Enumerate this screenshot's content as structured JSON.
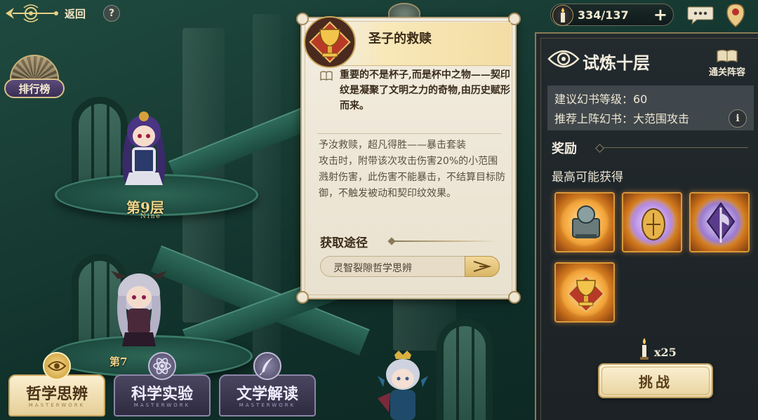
{
  "topbar": {
    "back_label": "返回",
    "help_glyph": "?",
    "stamina": "334/137",
    "plus_glyph": "+"
  },
  "left": {
    "rank_label": "排行榜",
    "floor9_label": "第9层",
    "floor9_sub": "Nine",
    "floor8_label": "第7"
  },
  "tooltip": {
    "title": "圣子的救赎",
    "quote": "重要的不是杯子,而是杯中之物——契印纹是凝聚了文明之力的奇物,由历史赋形而来。",
    "desc_1": "予汝救赎，超凡得胜——暴击套装",
    "desc_2": "攻击时，附带该次攻击伤害20%的小范围溅射伤害，此伤害不能暴击，不结算目标防御，不触发被动和契印纹效果。",
    "source_title": "获取途径",
    "source_item": "灵智裂隙哲学思辨"
  },
  "panel": {
    "title": "试炼十层",
    "team_label": "通关阵容",
    "rec_level": "建议幻书等级：60",
    "rec_book": "推荐上阵幻书：大范围攻击",
    "info_glyph": "i",
    "reward_title": "奖励",
    "reward_sub": "最高可能获得",
    "rewards": [
      "reward-icon-relic-stone",
      "reward-icon-golden-hand",
      "reward-icon-winged-axe",
      "reward-icon-holy-chalice"
    ],
    "cost": "x25",
    "challenge_label": "挑战"
  },
  "tabs": [
    {
      "label": "哲学思辨",
      "sub": "MASTERWORK",
      "active": true
    },
    {
      "label": "科学实验",
      "sub": "MASTERWORK",
      "active": false
    },
    {
      "label": "文学解读",
      "sub": "MASTERWORK",
      "active": false
    }
  ],
  "colors": {
    "accent_gold": "#d9b666",
    "panel_bg": "#1f2529",
    "card_bg": "#f1ebdc",
    "scene_green": "#1f4a3f"
  }
}
